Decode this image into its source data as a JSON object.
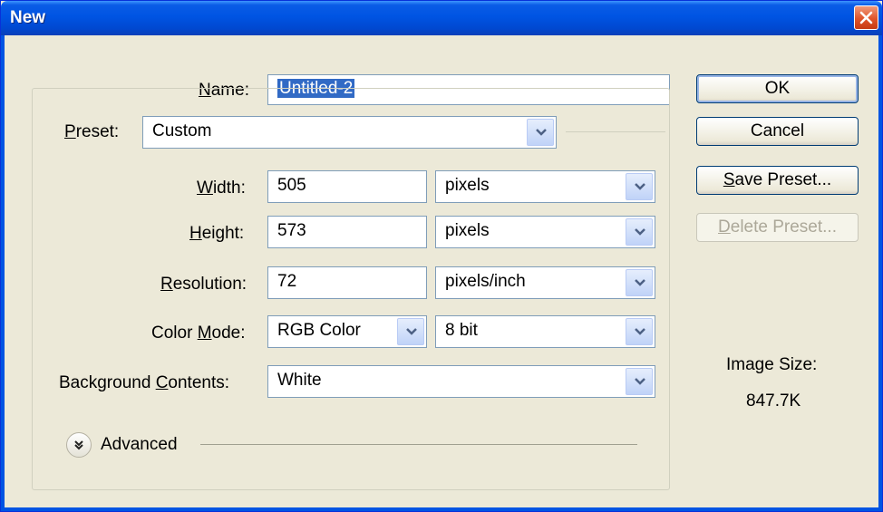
{
  "window": {
    "title": "New"
  },
  "form": {
    "name_label": "Name:",
    "name_value": "Untitled-2",
    "preset_label": "Preset:",
    "preset_value": "Custom",
    "width_label": "Width:",
    "width_value": "505",
    "width_unit": "pixels",
    "height_label": "Height:",
    "height_value": "573",
    "height_unit": "pixels",
    "resolution_label": "Resolution:",
    "resolution_value": "72",
    "resolution_unit": "pixels/inch",
    "color_mode_label": "Color Mode:",
    "color_mode_value": "RGB Color",
    "bit_depth_value": "8 bit",
    "background_label": "Background Contents:",
    "background_value": "White",
    "advanced_label": "Advanced"
  },
  "buttons": {
    "ok": "OK",
    "cancel": "Cancel",
    "save_preset": "Save Preset...",
    "delete_preset": "Delete Preset..."
  },
  "info": {
    "image_size_label": "Image Size:",
    "image_size_value": "847.7K"
  },
  "icons": {
    "close": "close-icon",
    "dropdown": "chevron-down-icon",
    "advanced": "double-chevron-down-icon"
  },
  "colors": {
    "titlebar": "#0054e3",
    "dialog_bg": "#ece9d8",
    "selection": "#316ac5",
    "close_button": "#e0542a"
  }
}
